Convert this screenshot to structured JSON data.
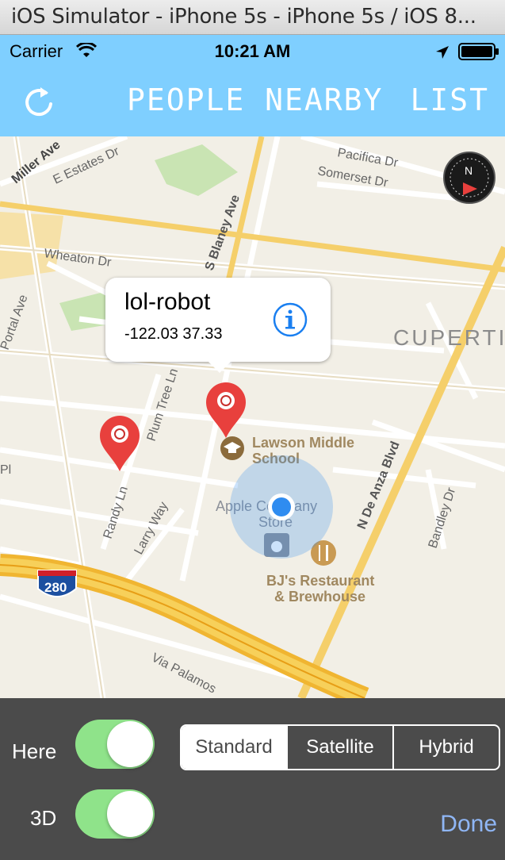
{
  "window": {
    "title": "iOS Simulator - iPhone 5s - iPhone 5s / iOS 8..."
  },
  "status": {
    "carrier": "Carrier",
    "time": "10:21 AM"
  },
  "nav": {
    "title": "PEOPLE NEARBY",
    "list_label": "LIST",
    "refresh_icon": "refresh-icon"
  },
  "map": {
    "streets": [
      "Miller Ave",
      "E Estates Dr",
      "Pacifica Dr",
      "Somerset Dr",
      "Wheaton Dr",
      "S Blaney Ave",
      "Portal Ave",
      "Plum Tree Ln",
      "Randy Ln",
      "Larry Way",
      "N De Anza Blvd",
      "Bandley Dr",
      "Via Palamos",
      "Pl"
    ],
    "city": "CUPERTI",
    "highway_shield": "280",
    "pois": [
      {
        "name_1": "Lawson Middle",
        "name_2": "School"
      },
      {
        "name_1": "Apple Company",
        "name_2": "Store"
      },
      {
        "name_1": "BJ's Restaurant",
        "name_2": "& Brewhouse"
      }
    ],
    "callout": {
      "title": "lol-robot",
      "coords": "-122.03  37.33"
    }
  },
  "controls": {
    "here_label": "Here",
    "three_d_label": "3D",
    "here_on": true,
    "three_d_on": true,
    "map_types": [
      "Standard",
      "Satellite",
      "Hybrid"
    ],
    "selected_map_type": "Standard",
    "done_label": "Done"
  },
  "colors": {
    "nav_bg": "#7fcfff",
    "toggle_on": "#8fe38a",
    "done": "#8fb6f5",
    "pin": "#e8403d",
    "user_location": "#2f8cf0"
  }
}
